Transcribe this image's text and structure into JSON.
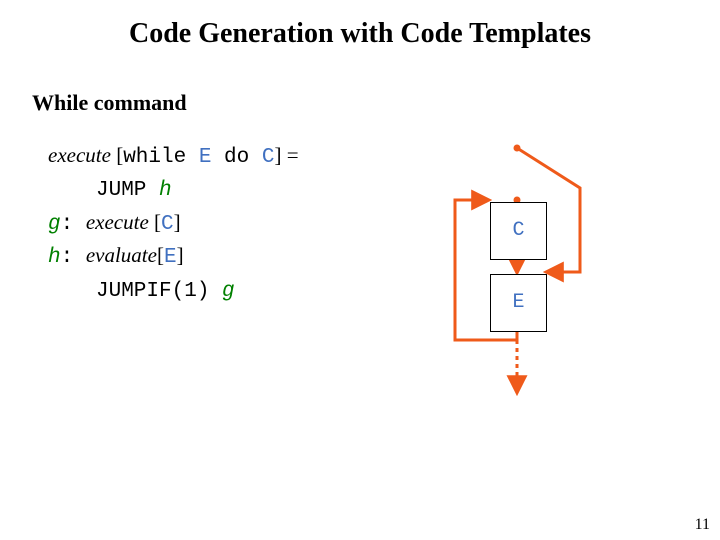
{
  "title": "Code Generation with Code Templates",
  "subhead": "While command",
  "def": {
    "lhs_exec": "execute ",
    "lhs_open": "[",
    "kw1": "while ",
    "var_e": "E",
    "kw2": " do ",
    "var_c": "C",
    "lhs_close": "] =",
    "line2_jump": "JUMP ",
    "line2_h": "h",
    "line3_g": "g",
    "line3_colon": ": ",
    "line3_exec": "execute ",
    "line3_open": "[",
    "line3_var": "C",
    "line3_close": "]",
    "line4_h": "h",
    "line4_colon": ": ",
    "line4_eval": "evaluate",
    "line4_open": "[",
    "line4_var": "E",
    "line4_close": "]",
    "line5_jumpif": "JUMPIF(1) ",
    "line5_g": "g"
  },
  "diagram": {
    "box_c": "C",
    "box_e": "E"
  },
  "pagenum": "11",
  "colors": {
    "flow": "#ef5a1a",
    "blue": "#4070c0",
    "green": "#008000"
  }
}
